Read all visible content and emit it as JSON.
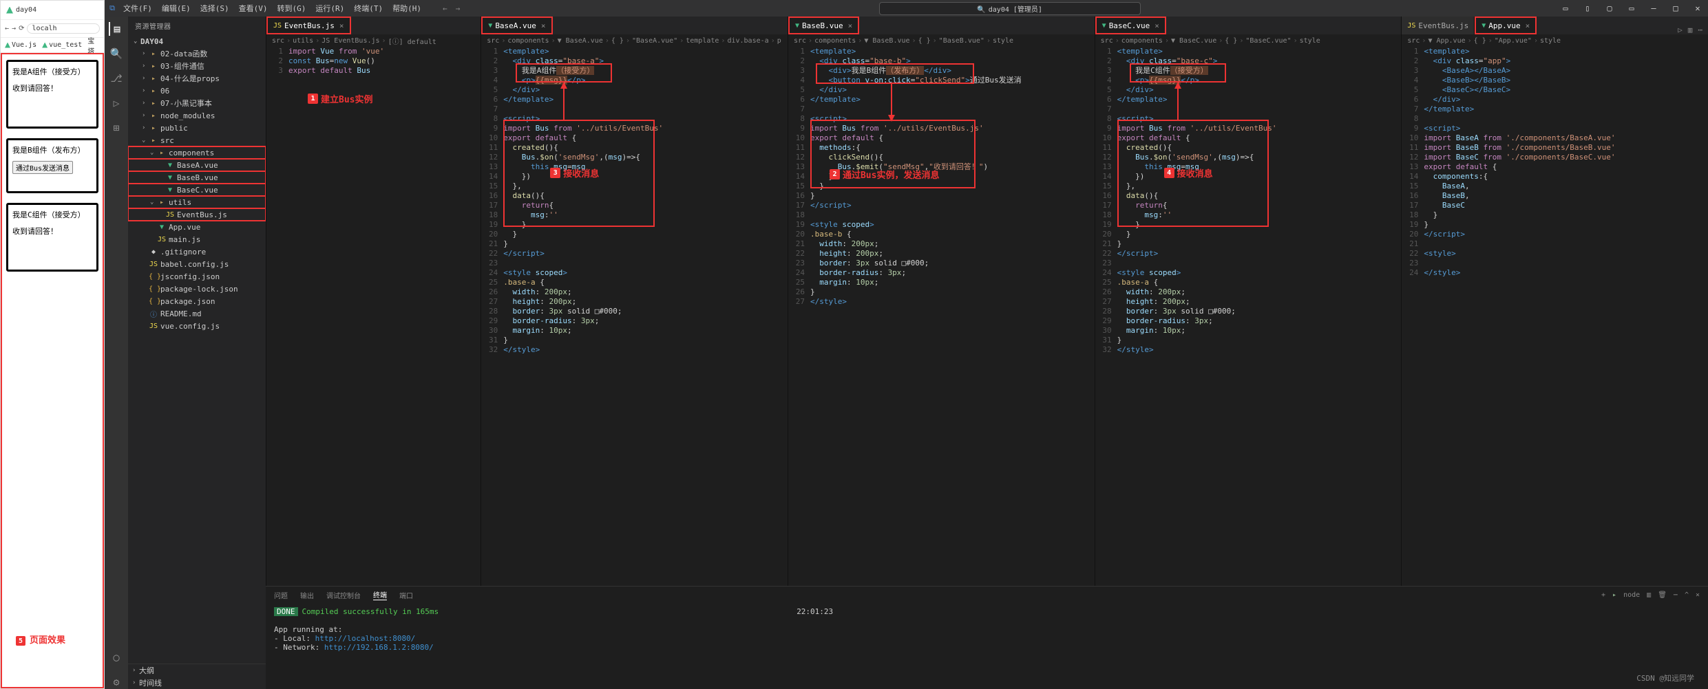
{
  "browser": {
    "tab_title": "day04",
    "url": "localh",
    "bookmarks": [
      "Vue.js",
      "vue_test",
      "宝塔"
    ],
    "compA_title": "我是A组件（接受方）",
    "compA_msg": "收到请回答！",
    "compB_title": "我是B组件（发布方）",
    "compB_btn": "通过Bus发送消息",
    "compC_title": "我是C组件（接受方）",
    "compC_msg": "收到请回答！",
    "anno5": "页面效果"
  },
  "menu": [
    "文件(F)",
    "编辑(E)",
    "选择(S)",
    "查看(V)",
    "转到(G)",
    "运行(R)",
    "终端(T)",
    "帮助(H)"
  ],
  "title_search": "day04 [管理员]",
  "sidebar": {
    "title": "资源管理器",
    "root": "DAY04",
    "items": [
      {
        "t": "02-data函数",
        "i": "folder",
        "d": 1,
        "chev": "›"
      },
      {
        "t": "03-组件通信",
        "i": "folder",
        "d": 1,
        "chev": "›"
      },
      {
        "t": "04-什么是props",
        "i": "folder",
        "d": 1,
        "chev": "›"
      },
      {
        "t": "06",
        "i": "folder",
        "d": 1,
        "chev": "›"
      },
      {
        "t": "07-小黑记事本",
        "i": "folder",
        "d": 1,
        "chev": "›"
      },
      {
        "t": "node_modules",
        "i": "folder",
        "d": 1,
        "chev": "›"
      },
      {
        "t": "public",
        "i": "folder",
        "d": 1,
        "chev": "›"
      },
      {
        "t": "src",
        "i": "folder",
        "d": 1,
        "chev": "⌄"
      },
      {
        "t": "components",
        "i": "folder",
        "d": 2,
        "chev": "⌄",
        "box": true
      },
      {
        "t": "BaseA.vue",
        "i": "vue",
        "d": 3,
        "box": true
      },
      {
        "t": "BaseB.vue",
        "i": "vue",
        "d": 3,
        "box": true
      },
      {
        "t": "BaseC.vue",
        "i": "vue",
        "d": 3,
        "box": true
      },
      {
        "t": "utils",
        "i": "folder",
        "d": 2,
        "chev": "⌄",
        "box": true
      },
      {
        "t": "EventBus.js",
        "i": "js",
        "d": 3,
        "box": true
      },
      {
        "t": "App.vue",
        "i": "vue",
        "d": 2
      },
      {
        "t": "main.js",
        "i": "js",
        "d": 2
      },
      {
        "t": ".gitignore",
        "i": "txt",
        "d": 1
      },
      {
        "t": "babel.config.js",
        "i": "js",
        "d": 1
      },
      {
        "t": "jsconfig.json",
        "i": "json",
        "d": 1
      },
      {
        "t": "package-lock.json",
        "i": "json",
        "d": 1
      },
      {
        "t": "package.json",
        "i": "json",
        "d": 1
      },
      {
        "t": "README.md",
        "i": "info",
        "d": 1
      },
      {
        "t": "vue.config.js",
        "i": "js",
        "d": 1
      }
    ],
    "outline": "大纲",
    "timeline": "时间线"
  },
  "editors": {
    "eventbus": {
      "tab": "EventBus.js",
      "crumb": [
        "src",
        "utils",
        "JS EventBus.js",
        "[ⓘ] default"
      ],
      "lines": [
        "import Vue from 'vue'",
        "const Bus=new Vue()",
        "export default Bus"
      ],
      "anno": "建立Bus实例"
    },
    "baseA": {
      "tab": "BaseA.vue",
      "crumb": [
        "src",
        "components",
        "▼ BaseA.vue",
        "{ }",
        "\"BaseA.vue\"",
        "template",
        "div.base-a",
        "p"
      ],
      "anno": "接收消息"
    },
    "baseB": {
      "tab": "BaseB.vue",
      "crumb": [
        "src",
        "components",
        "▼ BaseB.vue",
        "{ }",
        "\"BaseB.vue\"",
        "style"
      ],
      "anno": "通过Bus实例，发送消息"
    },
    "baseC": {
      "tab": "BaseC.vue",
      "crumb": [
        "src",
        "components",
        "▼ BaseC.vue",
        "{ }",
        "\"BaseC.vue\"",
        "style"
      ],
      "anno": "接收消息"
    },
    "app": {
      "tab": "App.vue",
      "other_tab": "EventBus.js",
      "crumb": [
        "src",
        "▼ App.vue",
        "{ }",
        "\"App.vue\"",
        "style"
      ]
    }
  },
  "terminal": {
    "tabs": [
      "问题",
      "输出",
      "调试控制台",
      "终端",
      "端口"
    ],
    "done": "DONE",
    "compiled": "Compiled successfully in 165ms",
    "time": "22:01:23",
    "running": "App running at:",
    "local_label": "- Local:   ",
    "local_url": "http://localhost:8080/",
    "net_label": "- Network: ",
    "net_url": "http://192.168.1.2:8080/",
    "right_label": "node"
  },
  "watermark": "CSDN @知远同学"
}
